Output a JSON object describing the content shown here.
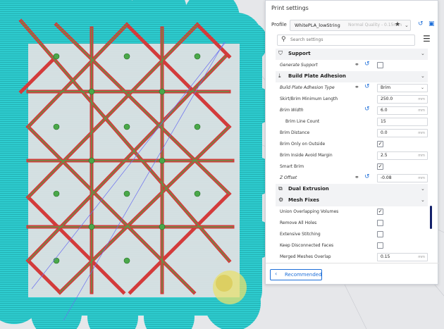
{
  "window": {
    "title": "Print settings"
  },
  "profile": {
    "label": "Profile",
    "name": "WhitePLA_lowString",
    "quality": "Normal Quality - 0.15mm"
  },
  "search": {
    "placeholder": "Search settings"
  },
  "categories": {
    "support": {
      "label": "Support",
      "settings": [
        {
          "label": "Generate Support",
          "checked": false
        }
      ]
    },
    "adhesion": {
      "label": "Build Plate Adhesion",
      "settings": [
        {
          "label": "Build Plate Adhesion Type",
          "value": "Brim"
        },
        {
          "label": "Skirt/Brim Minimum Length",
          "value": "250.0",
          "unit": "mm"
        },
        {
          "label": "Brim Width",
          "value": "6.0",
          "unit": "mm"
        },
        {
          "label": "Brim Line Count",
          "value": "15"
        },
        {
          "label": "Brim Distance",
          "value": "0.0",
          "unit": "mm"
        },
        {
          "label": "Brim Only on Outside",
          "checked": true
        },
        {
          "label": "Brim Inside Avoid Margin",
          "value": "2.5",
          "unit": "mm"
        },
        {
          "label": "Smart Brim",
          "checked": true
        },
        {
          "label": "Z Offset",
          "value": "-0.08",
          "unit": "mm"
        }
      ]
    },
    "dual": {
      "label": "Dual Extrusion"
    },
    "mesh": {
      "label": "Mesh Fixes",
      "settings": [
        {
          "label": "Union Overlapping Volumes",
          "checked": true
        },
        {
          "label": "Remove All Holes",
          "checked": false
        },
        {
          "label": "Extensive Stitching",
          "checked": false
        },
        {
          "label": "Keep Disconnected Faces",
          "checked": false
        },
        {
          "label": "Merged Meshes Overlap",
          "value": "0.15",
          "unit": "mm"
        }
      ]
    }
  },
  "footer": {
    "recommended_label": "Recommended"
  },
  "colors": {
    "brim": "#2ecdd0",
    "wall": "#d33b3b",
    "infill": "#4aa84a",
    "accent": "#1e6fd9",
    "scrollbar": "#13206a"
  }
}
